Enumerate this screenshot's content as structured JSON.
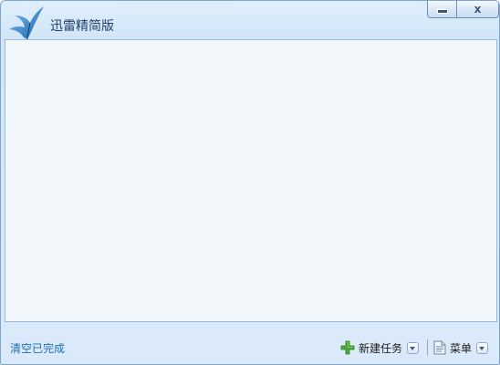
{
  "window": {
    "title": "迅雷精简版",
    "minimize_icon": "minimize-icon",
    "close_icon": "close-icon",
    "close_glyph": "x",
    "logo_icon": "thunder-bird-logo"
  },
  "footer": {
    "clear_completed": "清空已完成",
    "new_task": {
      "label": "新建任务",
      "icon": "plus-icon",
      "dropdown_icon": "chevron-down-icon"
    },
    "menu": {
      "label": "菜单",
      "icon": "document-icon",
      "dropdown_icon": "chevron-down-icon"
    }
  },
  "colors": {
    "accent": "#1d6fb8",
    "title_text": "#1f3f66",
    "content_bg": "#f2f7fc",
    "frame_bg": "#d2e6f8",
    "plus_green": "#4aa73a"
  }
}
